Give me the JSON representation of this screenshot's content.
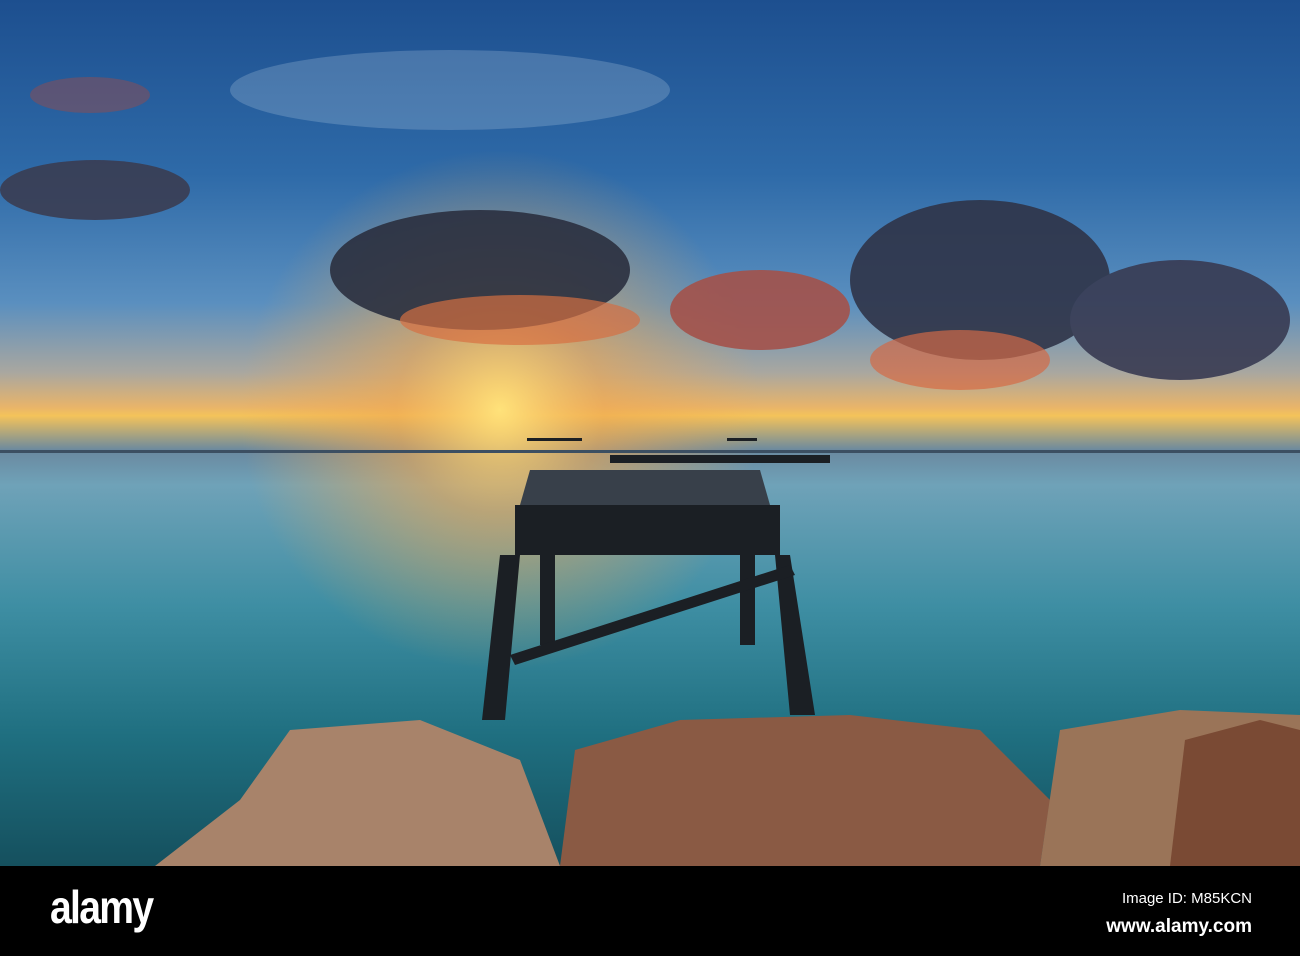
{
  "watermark": {
    "brand": "alamy",
    "tiled_text": "alamy"
  },
  "footer": {
    "logo": "alamy",
    "image_id": "Image ID: M85KCN",
    "website": "www.alamy.com"
  }
}
